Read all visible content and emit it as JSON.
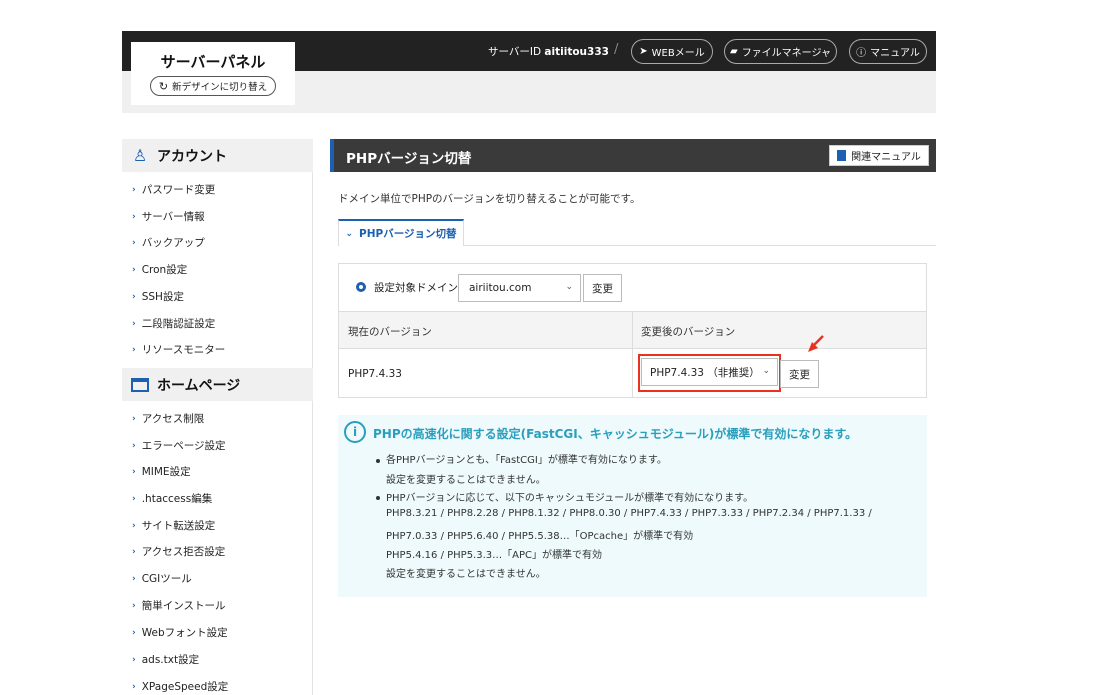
{
  "header": {
    "logo_title": "サーバーパネル",
    "new_design_label": "新デザインに切り替え",
    "server_id_label": "サーバーID",
    "server_id_value": "aitiitou333",
    "separator": "/",
    "webmail_label": "WEBメール",
    "file_manager_label": "ファイルマネージャ",
    "manual_label": "マニュアル"
  },
  "sidebar": {
    "account_title": "アカウント",
    "account_items": [
      "パスワード変更",
      "サーバー情報",
      "バックアップ",
      "Cron設定",
      "SSH設定",
      "二段階認証設定",
      "リソースモニター"
    ],
    "homepage_title": "ホームページ",
    "homepage_items": [
      "アクセス制限",
      "エラーページ設定",
      "MIME設定",
      ".htaccess編集",
      "サイト転送設定",
      "アクセス拒否設定",
      "CGIツール",
      "簡単インストール",
      "Webフォント設定",
      "ads.txt設定",
      "XPageSpeed設定"
    ]
  },
  "main": {
    "title": "PHPバージョン切替",
    "related_manual_label": "関連マニュアル",
    "description": "ドメイン単位でPHPのバージョンを切り替えることが可能です。",
    "tab_label": "PHPバージョン切替",
    "domain_label": "設定対象ドメイン",
    "domain_value": "airiitou.com",
    "change_label": "変更",
    "col_current": "現在のバージョン",
    "col_new": "変更後のバージョン",
    "current_version": "PHP7.4.33",
    "new_version_value": "PHP7.4.33 （非推奨）",
    "change_label_2": "変更"
  },
  "info": {
    "title": "PHPの高速化に関する設定(FastCGI、キャッシュモジュール)が標準で有効になります。",
    "b1_line1": "各PHPバージョンとも、「FastCGI」が標準で有効になります。",
    "b1_line2": "設定を変更することはできません。",
    "b2_line1": "PHPバージョンに応じて、以下のキャッシュモジュールが標準で有効になります。",
    "b2_line2": "PHP8.3.21 / PHP8.2.28 / PHP8.1.32 / PHP8.0.30 / PHP7.4.33 / PHP7.3.33 / PHP7.2.34 / PHP7.1.33 /",
    "b2_line3": "PHP7.0.33 / PHP5.6.40 / PHP5.5.38…「OPcache」が標準で有効",
    "b2_line4": "PHP5.4.16 / PHP5.3.3…「APC」が標準で有効",
    "b2_line5": "設定を変更することはできません。"
  },
  "colors": {
    "accent": "#1d5fb0",
    "highlight": "#e8321f",
    "info": "#2a9fbd"
  },
  "icons": [
    "refresh-icon",
    "paper-plane-icon",
    "folder-icon",
    "help-circle-icon",
    "person-icon",
    "window-icon",
    "chevron-right-icon",
    "chevron-down-icon",
    "book-icon",
    "info-icon",
    "arrow-icon"
  ]
}
